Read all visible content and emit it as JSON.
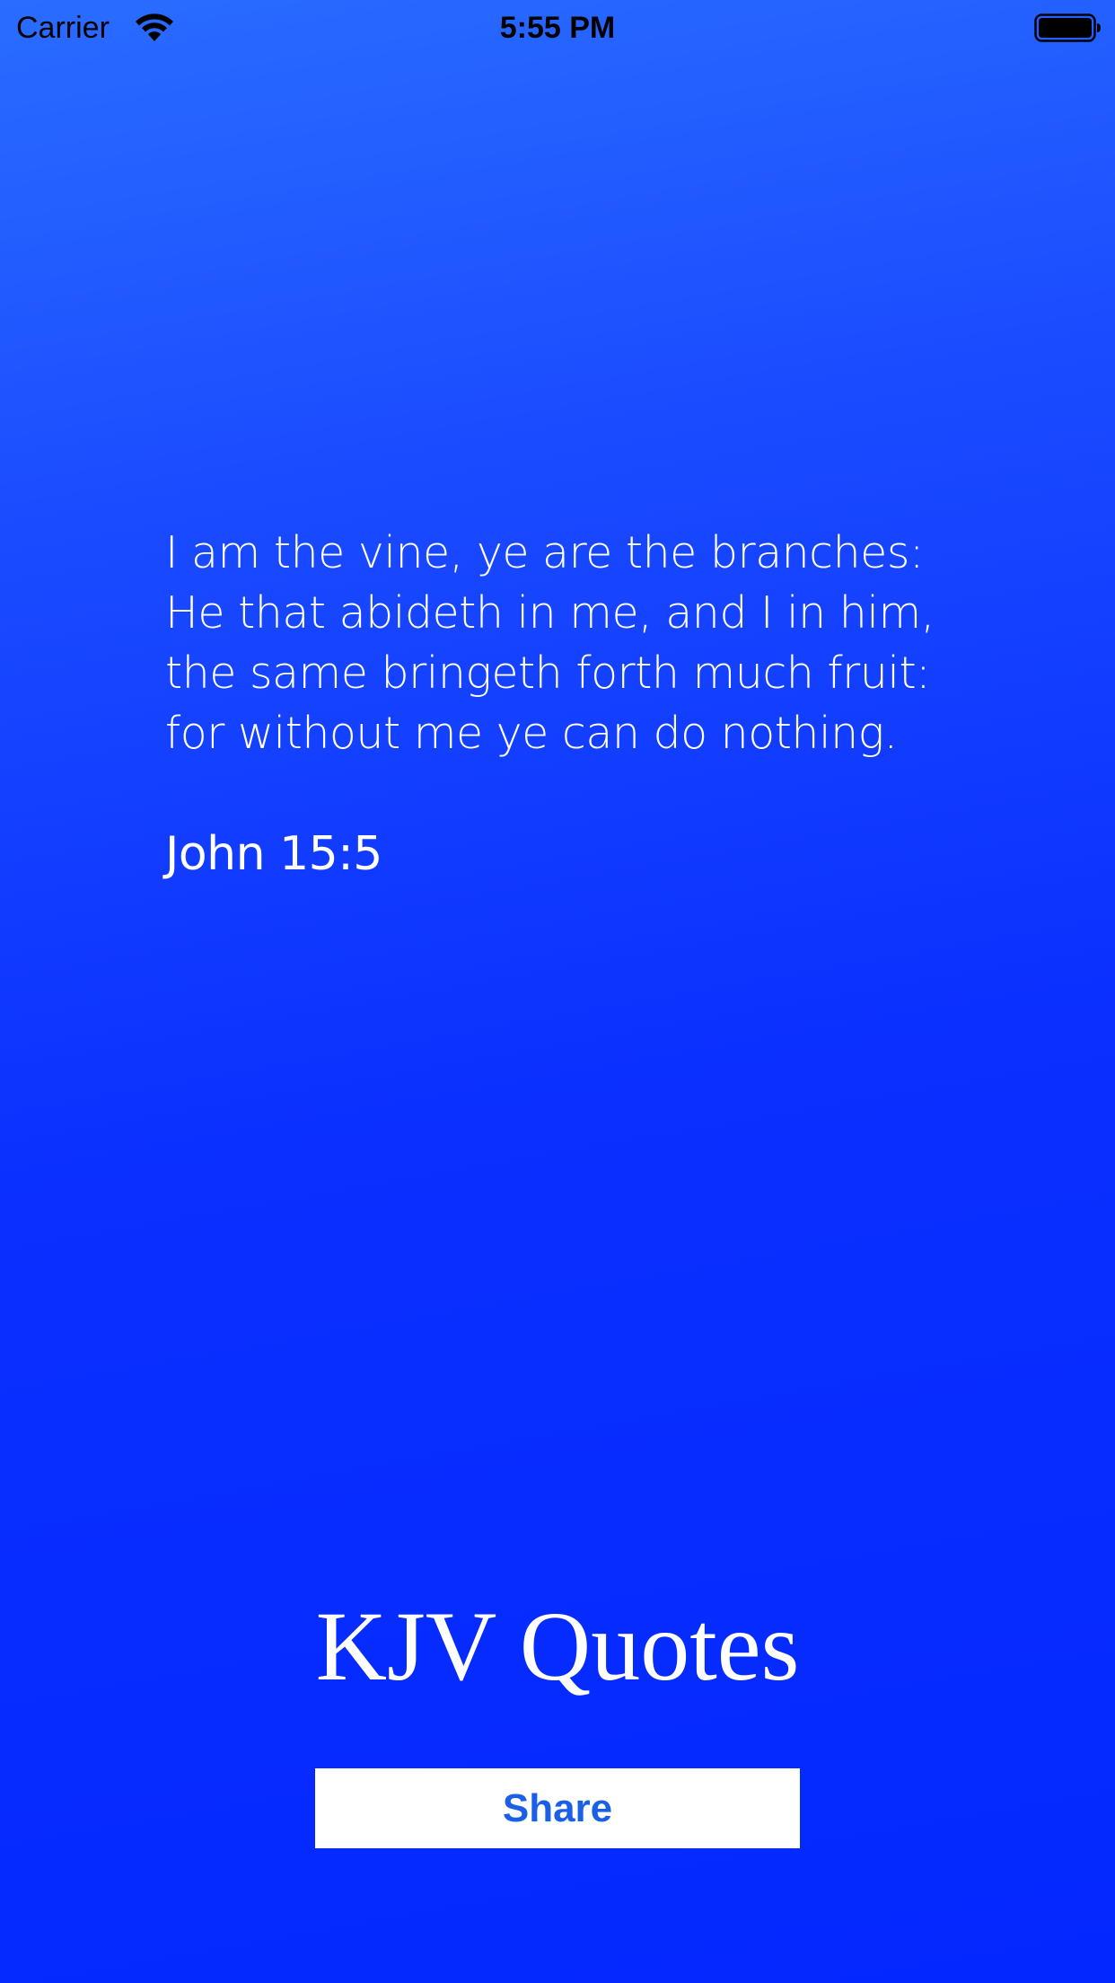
{
  "status_bar": {
    "carrier": "Carrier",
    "time": "5:55 PM"
  },
  "quote": {
    "lines": [
      "I am the vine, ye are the branches:",
      "He that abideth in me, and I in him,",
      "the same bringeth forth much fruit:",
      "for without me ye can do nothing."
    ],
    "reference": "John 15:5"
  },
  "app": {
    "title": "KJV Quotes"
  },
  "actions": {
    "share_label": "Share"
  },
  "colors": {
    "background_top": "#2a6cff",
    "background_bottom": "#0328ff",
    "text": "#ffffff",
    "button_bg": "#ffffff",
    "button_text": "#1a5fe6"
  },
  "icons": {
    "signal": "wifi-icon",
    "battery": "battery-icon"
  }
}
